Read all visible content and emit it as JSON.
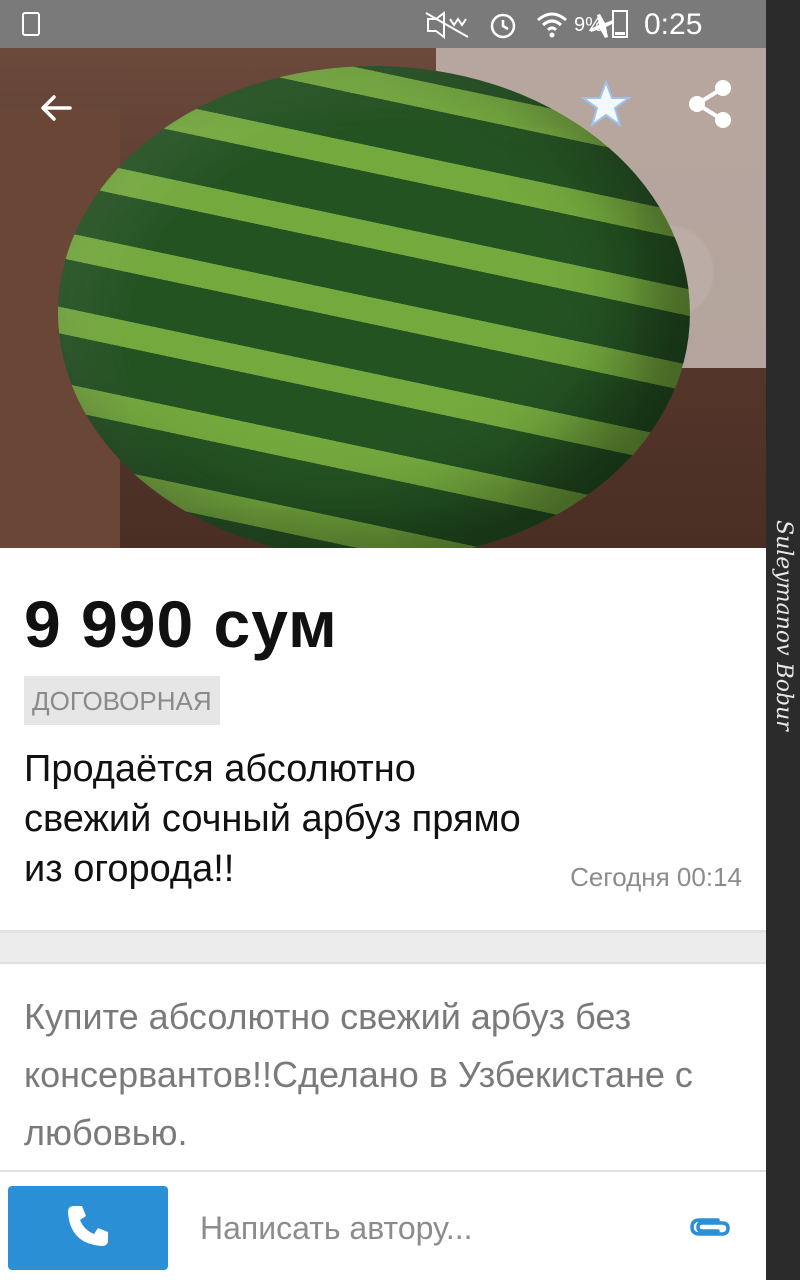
{
  "status_bar": {
    "battery_percent": "9%",
    "time": "0:25"
  },
  "listing": {
    "price": "9 990 сум",
    "negotiable_badge": "ДОГОВОРНАЯ",
    "title": "Продаётся абсолютно свежий сочный арбуз прямо из огорода!!",
    "date": "Сегодня 00:14",
    "description": "Купите абсолютно свежий арбуз без консервантов!!Сделано в Узбекистане с любовью."
  },
  "bottom_bar": {
    "message_placeholder": "Написать автору..."
  },
  "watermark": "Suleymanov Bobur",
  "icons": {
    "back": "arrow-left-icon",
    "favorite": "star-icon",
    "share": "share-icon",
    "call": "phone-icon",
    "attach": "paperclip-icon"
  },
  "colors": {
    "accent_blue": "#2a8fd5",
    "status_bar": "#7a7a7a"
  }
}
